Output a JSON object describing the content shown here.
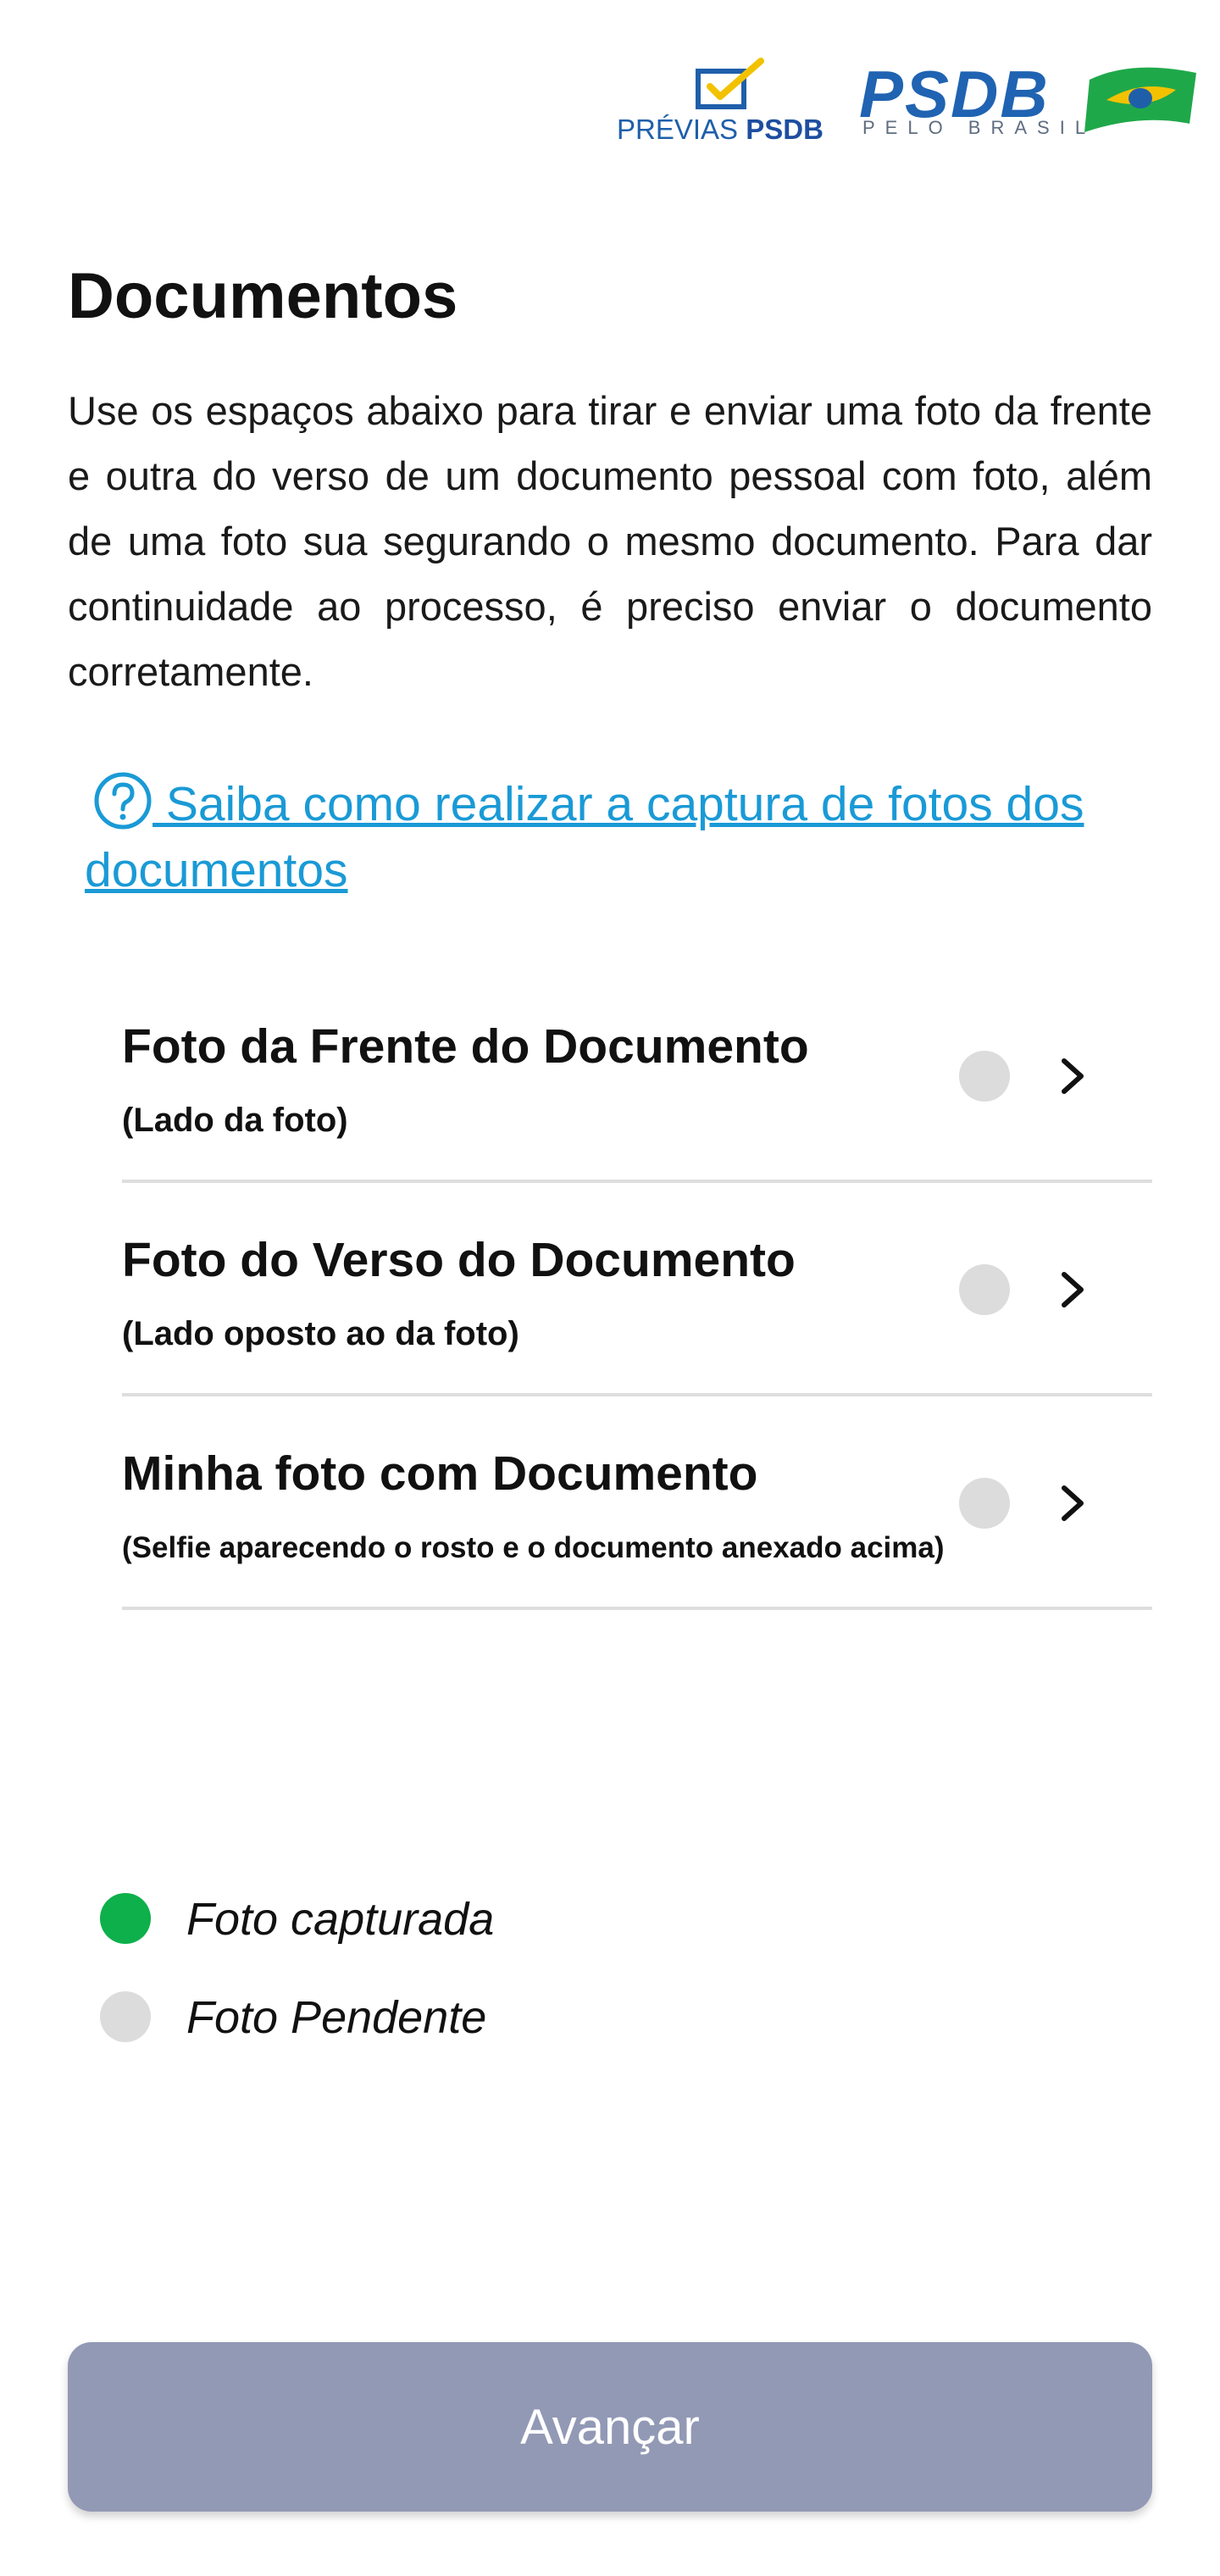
{
  "header": {
    "previas_logo": {
      "text_prefix": "PRÉVIAS",
      "text_brand": "PSDB",
      "icon": "ballot-box-icon"
    },
    "psdb_logo": {
      "word": "PSDB",
      "tagline": "PELO BRASIL",
      "icon": "brazil-flag-icon"
    }
  },
  "page": {
    "title": "Documentos",
    "intro": "Use os espaços abaixo para tirar e enviar uma foto da frente e outra do verso de um documento pessoal com foto, além de uma foto sua segurando o mesmo documento. Para dar continuidade ao processo, é preciso enviar o documento corretamente."
  },
  "help_link": {
    "icon": "question-circle-icon",
    "label": " Saiba como realizar a captura de fotos dos documentos"
  },
  "documents": [
    {
      "title": "Foto da Frente do Documento",
      "subtitle": "(Lado da foto)",
      "status": "pendente"
    },
    {
      "title": "Foto do Verso do Documento",
      "subtitle": "(Lado oposto ao da foto)",
      "status": "pendente"
    },
    {
      "title": "Minha foto com Documento",
      "subtitle": "(Selfie aparecendo o rosto e o documento anexado acima)",
      "status": "pendente"
    }
  ],
  "legend": {
    "captured": {
      "label": "Foto capturada",
      "color": "#0db04b"
    },
    "pending": {
      "label": "Foto Pendente",
      "color": "#dcdcdc"
    }
  },
  "actions": {
    "advance_label": "Avançar"
  },
  "colors": {
    "link": "#1a9ad6",
    "button_disabled": "#9299b5",
    "brand_blue": "#1f63b2"
  }
}
